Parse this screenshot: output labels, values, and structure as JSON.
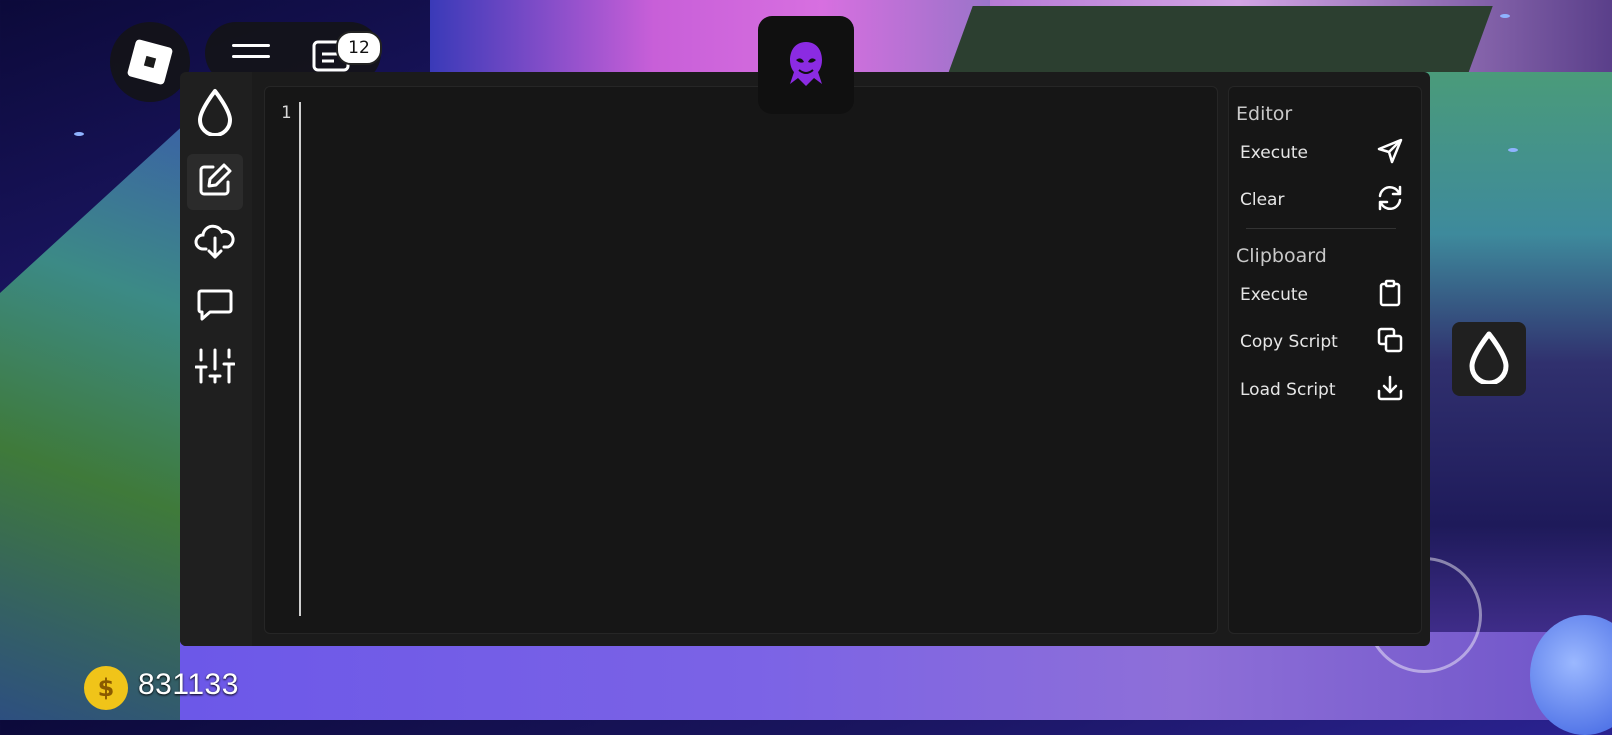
{
  "topbar": {
    "notification_count": "12"
  },
  "editor": {
    "line_number": "1",
    "content": ""
  },
  "side_panel": {
    "editor_section": {
      "title": "Editor",
      "actions": [
        {
          "label": "Execute",
          "icon": "send-icon"
        },
        {
          "label": "Clear",
          "icon": "refresh-icon"
        }
      ]
    },
    "clipboard_section": {
      "title": "Clipboard",
      "actions": [
        {
          "label": "Execute",
          "icon": "clipboard-icon"
        },
        {
          "label": "Copy Script",
          "icon": "copy-icon"
        },
        {
          "label": "Load Script",
          "icon": "download-icon"
        }
      ]
    }
  },
  "rail": {
    "items": [
      {
        "icon": "droplet-logo-icon",
        "active": false
      },
      {
        "icon": "edit-icon",
        "active": true
      },
      {
        "icon": "cloud-download-icon",
        "active": false
      },
      {
        "icon": "chat-icon",
        "active": false
      },
      {
        "icon": "sliders-icon",
        "active": false
      }
    ]
  },
  "currency": {
    "coin_symbol": "$",
    "amount": "831133"
  },
  "colors": {
    "panel_bg": "#1b1b1b",
    "editor_bg": "#161616",
    "text": "#e6e6e6",
    "coin": "#f0c419",
    "avatar_accent": "#8b2be2"
  }
}
